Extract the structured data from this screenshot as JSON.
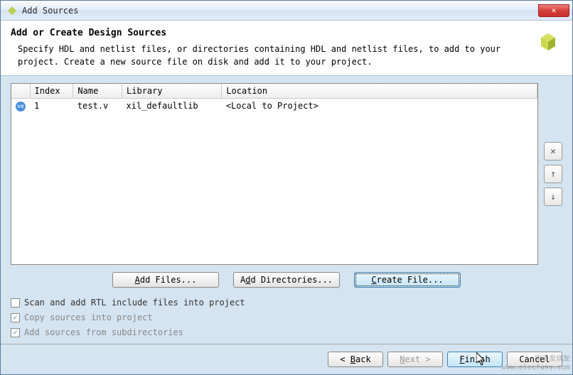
{
  "window": {
    "title": "Add Sources"
  },
  "header": {
    "title": "Add or Create Design Sources",
    "description": "Specify HDL and netlist files, or directories containing HDL and netlist files, to add to your project. Create a new source file on disk and add it to your project."
  },
  "table": {
    "columns": [
      "",
      "Index",
      "Name",
      "Library",
      "Location"
    ],
    "rows": [
      {
        "icon": "ve",
        "index": "1",
        "name": "test.v",
        "library": "xil_defaultlib",
        "location": "<Local to Project>"
      }
    ]
  },
  "side_buttons": {
    "remove": "✕",
    "up": "↑",
    "down": "↓"
  },
  "action_buttons": {
    "add_files": "Add Files...",
    "add_dirs": "Add Directories...",
    "create_file": "Create File..."
  },
  "checkboxes": {
    "scan_rtl": {
      "label": "Scan and add RTL include files into project",
      "checked": false,
      "enabled": true
    },
    "copy_sources": {
      "label": "Copy sources into project",
      "checked": true,
      "enabled": false
    },
    "add_subdirs": {
      "label": "Add sources from subdirectories",
      "checked": true,
      "enabled": false
    }
  },
  "nav": {
    "back": "< Back",
    "next": "Next >",
    "finish": "Finish",
    "cancel": "Cancel"
  },
  "watermark": {
    "line1": "电子发烧友",
    "line2": "www.elecfans.com"
  }
}
